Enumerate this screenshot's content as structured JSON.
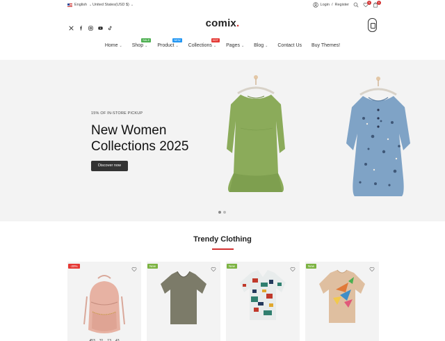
{
  "topbar": {
    "language": "English",
    "currency": "United States(USD $)",
    "login": "Login",
    "separator": "/",
    "register": "Register",
    "wishlist_count": "0",
    "cart_count": "0"
  },
  "header": {
    "logo_text": "comix",
    "logo_dot": ".",
    "social_icons": [
      "x-icon",
      "facebook-icon",
      "instagram-icon",
      "youtube-icon",
      "tiktok-icon"
    ]
  },
  "nav": [
    {
      "label": "Home",
      "dropdown": true,
      "tag": "",
      "tag_color": ""
    },
    {
      "label": "Shop",
      "dropdown": true,
      "tag": "SALE",
      "tag_color": "#4caf50"
    },
    {
      "label": "Product",
      "dropdown": true,
      "tag": "NEW",
      "tag_color": "#2196f3"
    },
    {
      "label": "Collections",
      "dropdown": true,
      "tag": "HOT",
      "tag_color": "#e53935"
    },
    {
      "label": "Pages",
      "dropdown": true,
      "tag": "",
      "tag_color": ""
    },
    {
      "label": "Blog",
      "dropdown": true,
      "tag": "",
      "tag_color": ""
    },
    {
      "label": "Contact Us",
      "dropdown": false,
      "tag": "",
      "tag_color": ""
    },
    {
      "label": "Buy Themes!",
      "dropdown": false,
      "tag": "",
      "tag_color": ""
    }
  ],
  "hero": {
    "subtitle": "15% OF IN-STORE PICKUP",
    "title_line1": "New Women",
    "title_line2": "Collections 2025",
    "cta_label": "Discover now"
  },
  "section": {
    "title": "Trendy Clothing"
  },
  "products": [
    {
      "tag": "-20%",
      "tag_color": "#e53935",
      "sizes": [
        "453",
        "31",
        "13",
        "43"
      ]
    },
    {
      "tag": "New",
      "tag_color": "#7cb342",
      "sizes": []
    },
    {
      "tag": "New",
      "tag_color": "#7cb342",
      "sizes": []
    },
    {
      "tag": "New",
      "tag_color": "#7cb342",
      "sizes": []
    }
  ],
  "colors": {
    "accent": "#d32f2f",
    "hero_bg": "#f3f3f3",
    "button_dark": "#333333"
  }
}
